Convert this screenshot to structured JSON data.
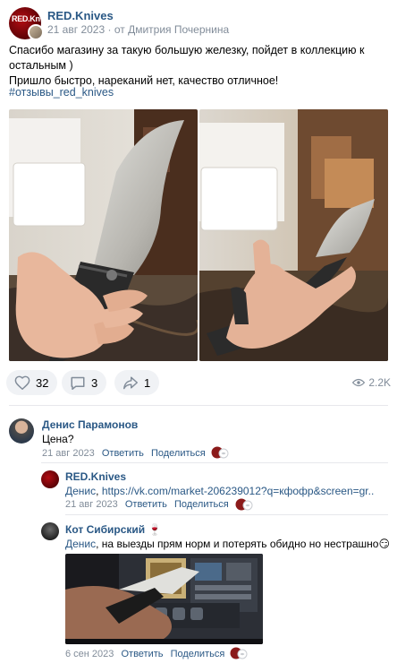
{
  "post": {
    "author": "RED.Knives",
    "avatar_text": "RED.Kn",
    "date": "21 авг 2023",
    "from_prefix": "· от",
    "from_author": "Дмитрия Почернина",
    "text_line1": "Спасибо магазину за такую большую железку, пойдет в коллекцию к остальным )",
    "text_line2": "Пришло быстро, нареканий нет, качество отличное!",
    "hashtag": "#отзывы_red_knives"
  },
  "actions": {
    "likes": "32",
    "comments": "3",
    "shares": "1",
    "views": "2.2K"
  },
  "comments": [
    {
      "author": "Денис Парамонов",
      "text": "Цена?",
      "date": "21 авг 2023",
      "reply_label": "Ответить",
      "share_label": "Поделиться"
    },
    {
      "author": "RED.Knives",
      "mention": "Денис",
      "link": "https://vk.com/market-206239012?q=кфофр&screen=gr..",
      "date": "21 авг 2023",
      "reply_label": "Ответить",
      "share_label": "Поделиться"
    },
    {
      "author": "Кот Сибирский",
      "author_emoji": "🍷",
      "mention": "Денис",
      "text": ", на выезды прям норм и потерять обидно но нестрашно",
      "emoji": "😏",
      "date": "6 сен 2023",
      "reply_label": "Ответить",
      "share_label": "Поделиться"
    }
  ],
  "colors": {
    "link": "#2a5885",
    "meta": "#818c99",
    "pill_bg": "#f0f2f5",
    "brand_red": "#b30d13"
  },
  "icons": [
    "heart-icon",
    "comment-icon",
    "share-icon",
    "eye-icon",
    "reaction-icon"
  ]
}
